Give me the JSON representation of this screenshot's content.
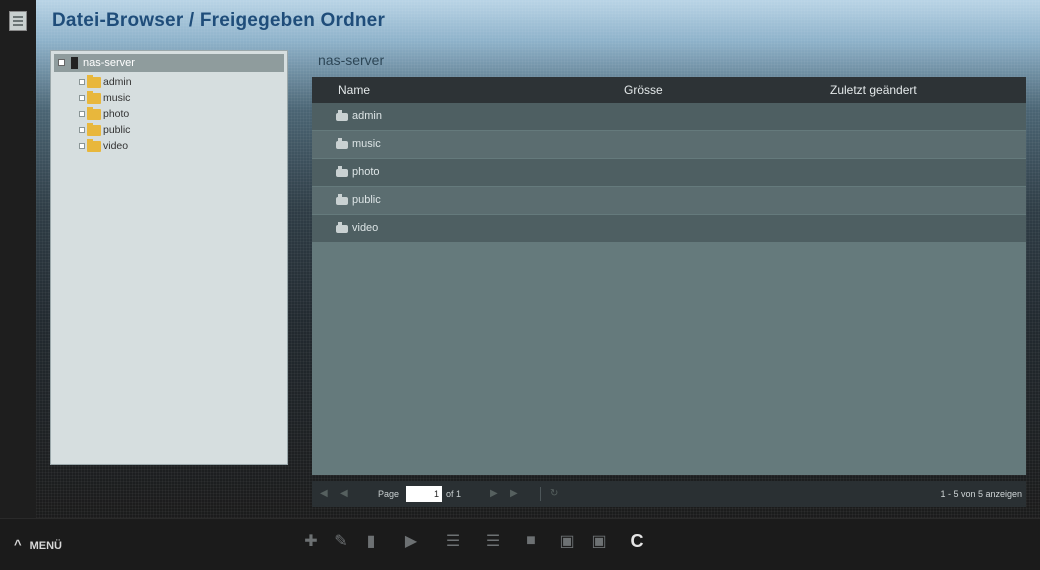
{
  "window": {
    "title": "Datei-Browser / Freigegeben Ordner"
  },
  "tree": {
    "root": "nas-server",
    "items": [
      "admin",
      "music",
      "photo",
      "public",
      "video"
    ]
  },
  "breadcrumb": "nas-server",
  "grid": {
    "columns": [
      "Name",
      "Grösse",
      "Zuletzt geändert"
    ],
    "rows": [
      {
        "name": "admin",
        "size": "",
        "modified": ""
      },
      {
        "name": "music",
        "size": "",
        "modified": ""
      },
      {
        "name": "photo",
        "size": "",
        "modified": ""
      },
      {
        "name": "public",
        "size": "",
        "modified": ""
      },
      {
        "name": "video",
        "size": "",
        "modified": ""
      }
    ]
  },
  "pager": {
    "page_label": "Page",
    "page_value": "1",
    "of_label": "of 1",
    "status": "1 - 5 von 5 anzeigen"
  },
  "bottombar": {
    "menu_label": "MENÜ",
    "tools": [
      "add-icon",
      "edit-icon",
      "delete-icon",
      "rename-icon",
      "upload-icon",
      "download-icon",
      "move-icon",
      "copy-icon",
      "paste-icon",
      "refresh-icon"
    ]
  }
}
